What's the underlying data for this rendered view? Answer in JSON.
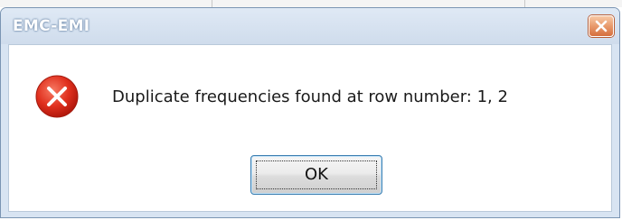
{
  "window": {
    "title": "EMC-EMI"
  },
  "dialog": {
    "icon": "error-icon",
    "message": "Duplicate frequencies found at row number: 1, 2",
    "ok_label": "OK"
  },
  "colors": {
    "error_red": "#e0301e",
    "close_orange": "#e0804c",
    "button_border": "#3c7fb1"
  }
}
